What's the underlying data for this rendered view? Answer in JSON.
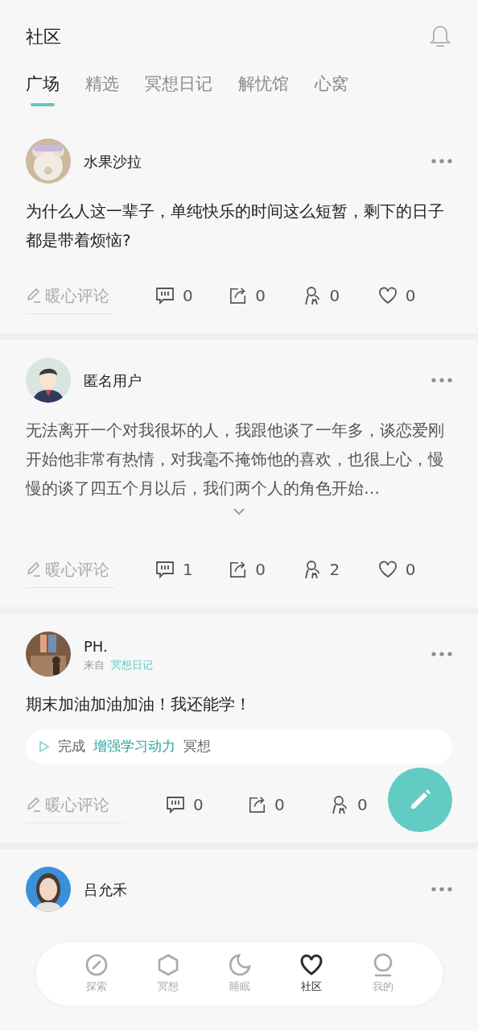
{
  "header": {
    "title": "社区"
  },
  "tabs": [
    {
      "label": "广场",
      "selected": true
    },
    {
      "label": "精选",
      "selected": false
    },
    {
      "label": "冥想日记",
      "selected": false
    },
    {
      "label": "解忧馆",
      "selected": false
    },
    {
      "label": "心窝",
      "selected": false
    }
  ],
  "posts": [
    {
      "author": "水果沙拉",
      "text": "为什么人这一辈子，单纯快乐的时间这么短暂，剩下的日子都是带着烦恼?",
      "comment_placeholder": "暖心评论",
      "stats": [
        {
          "kind": "comment",
          "count": "0"
        },
        {
          "kind": "share",
          "count": "0"
        },
        {
          "kind": "hug",
          "count": "0"
        },
        {
          "kind": "like",
          "count": "0"
        }
      ]
    },
    {
      "author": "匿名用户",
      "text": "无法离开一个对我很坏的人，我跟他谈了一年多，谈恋爱刚开始他非常有热情，对我毫不掩饰他的喜欢，也很上心，慢慢的谈了四五个月以后，我们两个人的角色开始…",
      "expanded": false,
      "comment_placeholder": "暖心评论",
      "stats": [
        {
          "kind": "comment",
          "count": "1"
        },
        {
          "kind": "share",
          "count": "0"
        },
        {
          "kind": "hug",
          "count": "2"
        },
        {
          "kind": "like",
          "count": "0"
        }
      ]
    },
    {
      "author": "PH.",
      "source_prefix": "来自",
      "source": "冥想日记",
      "text": "期末加油加油加油！我还能学！",
      "task": {
        "prefix": "完成",
        "name": "增强学习动力",
        "suffix": "冥想"
      },
      "comment_placeholder": "暖心评论",
      "stats": [
        {
          "kind": "comment",
          "count": "0"
        },
        {
          "kind": "share",
          "count": "0"
        },
        {
          "kind": "hug",
          "count": "0"
        }
      ]
    },
    {
      "author": "吕允禾"
    }
  ],
  "nav": [
    {
      "label": "探索",
      "selected": false
    },
    {
      "label": "冥想",
      "selected": false
    },
    {
      "label": "睡眠",
      "selected": false
    },
    {
      "label": "社区",
      "selected": true
    },
    {
      "label": "我的",
      "selected": false
    }
  ]
}
